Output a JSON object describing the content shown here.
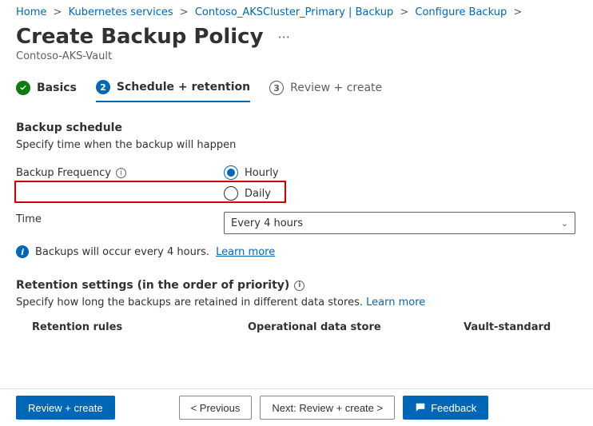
{
  "breadcrumb": {
    "items": [
      "Home",
      "Kubernetes services",
      "Contoso_AKSCluster_Primary | Backup",
      "Configure Backup"
    ],
    "separator": ">"
  },
  "page": {
    "title": "Create Backup Policy",
    "subtitle": "Contoso-AKS-Vault"
  },
  "steps": {
    "basics": "Basics",
    "schedule_num": "2",
    "schedule_label": "Schedule + retention",
    "review_num": "3",
    "review_label": "Review + create"
  },
  "schedule": {
    "section_title": "Backup schedule",
    "section_desc": "Specify time when the backup will happen",
    "freq_label": "Backup Frequency",
    "options": {
      "hourly": "Hourly",
      "daily": "Daily"
    },
    "time_label": "Time",
    "time_value": "Every 4 hours",
    "info_text": "Backups will occur every 4 hours.",
    "info_link": "Learn more"
  },
  "retention": {
    "title": "Retention settings (in the order of priority)",
    "desc_prefix": "Specify how long the backups are retained in different data stores.",
    "desc_link": "Learn more",
    "col_rules": "Retention rules",
    "col_operational": "Operational data store",
    "col_vault": "Vault-standard"
  },
  "footer": {
    "review_create": "Review + create",
    "previous": "<  Previous",
    "next": "Next: Review + create  >",
    "feedback": "Feedback"
  }
}
